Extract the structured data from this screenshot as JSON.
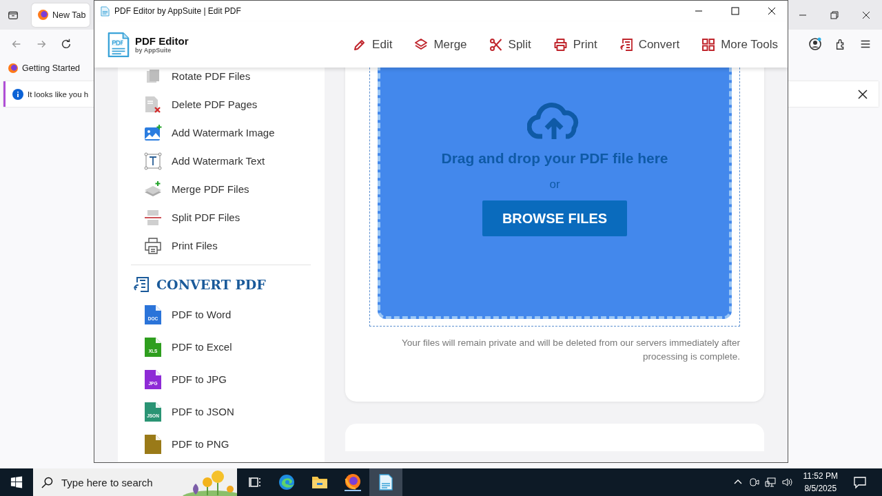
{
  "browser": {
    "tabs": [
      {
        "label": "New Tab",
        "selected": true
      }
    ],
    "bookmarks": [
      "Getting Started"
    ],
    "notification": "It looks like you h"
  },
  "app": {
    "title": "PDF Editor by AppSuite | Edit PDF",
    "logo": {
      "name": "PDF Editor",
      "tagline": "by AppSuite"
    },
    "nav": [
      {
        "label": "Edit"
      },
      {
        "label": "Merge"
      },
      {
        "label": "Split"
      },
      {
        "label": "Print"
      },
      {
        "label": "Convert"
      },
      {
        "label": "More Tools"
      }
    ],
    "tools": [
      {
        "label": "Rotate PDF Files"
      },
      {
        "label": "Delete PDF Pages"
      },
      {
        "label": "Add Watermark Image"
      },
      {
        "label": "Add Watermark Text"
      },
      {
        "label": "Merge PDF Files"
      },
      {
        "label": "Split PDF Files"
      },
      {
        "label": "Print Files"
      }
    ],
    "convert_section": {
      "title": "CONVERT PDF",
      "items": [
        {
          "label": "PDF to Word",
          "badge": "DOC",
          "color": "#2b74d9"
        },
        {
          "label": "PDF to Excel",
          "badge": "XLS",
          "color": "#2e9e1e"
        },
        {
          "label": "PDF to JPG",
          "badge": "JPG",
          "color": "#8e2bd6"
        },
        {
          "label": "PDF to JSON",
          "badge": "JSON",
          "color": "#2a9474"
        },
        {
          "label": "PDF to PNG",
          "color": "#9a7a18"
        }
      ]
    },
    "upload": {
      "heading": "Drag and drop your PDF file here",
      "or": "or",
      "button": "BROWSE FILES",
      "note": "Your files will remain private and will be deleted from our servers immediately after processing is complete."
    }
  },
  "taskbar": {
    "search_placeholder": "Type here to search",
    "time": "11:52 PM",
    "date": "8/5/2025"
  }
}
